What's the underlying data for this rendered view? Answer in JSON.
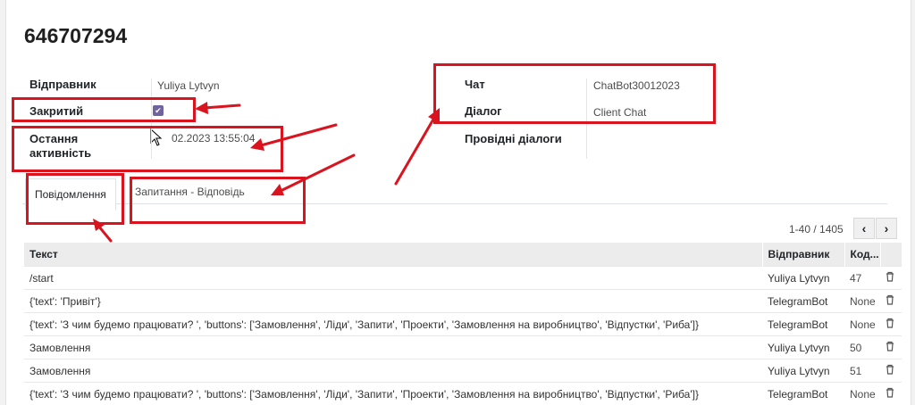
{
  "record": {
    "title": "646707294"
  },
  "fields": {
    "sender_label": "Відправник",
    "sender_value": "Yuliya Lytvyn",
    "closed_label": "Закритий",
    "closed_checked": true,
    "last_activity_label_1": "Остання",
    "last_activity_label_2": "активність",
    "last_activity_value": "02.2023 13:55:04",
    "chat_label": "Чат",
    "chat_value": "ChatBot30012023",
    "dialog_label": "Діалог",
    "dialog_value": "Client Chat",
    "lead_dialogs_label": "Провідні діалоги"
  },
  "tabs": [
    {
      "label": "Повідомлення",
      "active": true
    },
    {
      "label": "Запитання - Відповідь",
      "active": false
    }
  ],
  "pager": {
    "value": "1-40 / 1405",
    "prev": "‹",
    "next": "›"
  },
  "table": {
    "columns": [
      "Текст",
      "Відправник",
      "Код..."
    ],
    "rows": [
      {
        "text": "/start",
        "sender": "Yuliya Lytvyn",
        "code": "47"
      },
      {
        "text": "{'text': 'Привіт'}",
        "sender": "TelegramBot",
        "code": "None"
      },
      {
        "text": "{'text': 'З чим будемо працювати? ', 'buttons': ['Замовлення', 'Ліди', 'Запити', 'Проекти', 'Замовлення на виробництво', 'Відпустки', 'Риба']}",
        "sender": "TelegramBot",
        "code": "None"
      },
      {
        "text": "Замовлення",
        "sender": "Yuliya Lytvyn",
        "code": "50"
      },
      {
        "text": "Замовлення",
        "sender": "Yuliya Lytvyn",
        "code": "51"
      },
      {
        "text": "{'text': 'З чим будемо працювати? ', 'buttons': ['Замовлення', 'Ліди', 'Запити', 'Проекти', 'Замовлення на виробництво', 'Відпустки', 'Риба']}",
        "sender": "TelegramBot",
        "code": "None"
      }
    ]
  },
  "icons": {
    "checkbox": "checkbox-checked-icon",
    "cursor": "mouse-cursor-icon",
    "trash": "trash-icon"
  },
  "colors": {
    "checkbox": "#71639e",
    "annotation": "#d9141f",
    "table_header": "#ececec"
  }
}
